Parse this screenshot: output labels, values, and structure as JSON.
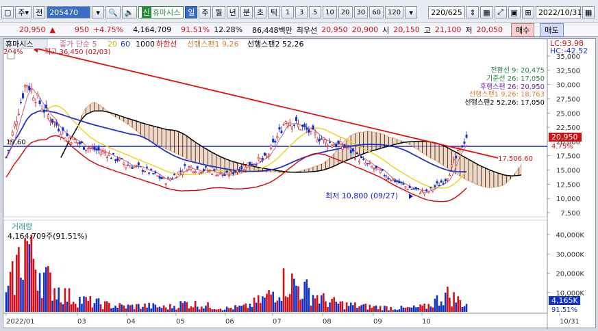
{
  "toolbar": {
    "market": "주",
    "jeon": "전",
    "code": "205470",
    "stock_name": "휴마시스",
    "stock_tag": "신",
    "period_day": "일",
    "period_week": "주",
    "period_month": "월",
    "period_year": "년",
    "period_min": "분",
    "period_tick": "초",
    "period_tick2": "틱",
    "intervals": [
      "1",
      "3",
      "5",
      "10",
      "20",
      "30",
      "60",
      "120"
    ],
    "count": "220/625",
    "date": "2022/10/31"
  },
  "quote": {
    "price": "20,950",
    "arrow": "▲",
    "change": "950",
    "change_pct": "+4.75%",
    "volume": "4,164,709",
    "vol_ratio": "91.51%",
    "turnover": "12.28%",
    "amount": "86,448백만",
    "best_ask_label": "최우선",
    "best_ask": "20,950",
    "best_bid": "20,900",
    "open_label": "시",
    "open": "20,150",
    "high_label": "고",
    "high": "21,100",
    "low_label": "저",
    "low": "20,050",
    "buy_label": "매수",
    "sell_label": "매도"
  },
  "price_pane": {
    "stock_label": "휴마시스",
    "legend_ma": "종가 단순 5",
    "legend_20": "20",
    "legend_60": "60",
    "legend_1000": "1000",
    "legend_lower": "하한선",
    "legend_span1": "선행스팬1 9,26",
    "legend_span2": "선행스팬2 52,26",
    "lc": "LC:93.98",
    "hc": "HC:-42.52",
    "pct_label": "204%",
    "high_note": "최고 36,450 (02/03)",
    "low_note": "최저 10,800 (09/27)",
    "left_level": "19,60",
    "cloud_level": "17,506.60",
    "cur_price_tag": "20,950",
    "cur_pct_tag": "4.75%",
    "ichimoku": [
      "전환선 9: 20,475",
      "기준선 26: 17,050",
      "후행스팬 26: 20,950",
      "선행스팬1 9,26: 18,763",
      "선행스팬2 52,26: 17,050"
    ],
    "y_ticks": [
      "35,000",
      "32,500",
      "30,000",
      "27,500",
      "25,000",
      "22,500",
      "20,000",
      "17,500",
      "15,000",
      "12,500",
      "10,000",
      "7,500"
    ]
  },
  "volume_pane": {
    "title": "거래량",
    "info": "4,164,709주(91.51%)",
    "y_ticks": [
      "40,000K",
      "30,000K",
      "20,000K",
      "10,000K"
    ],
    "cur_tag": "4,165K",
    "cur_pct": "91.51%"
  },
  "x_axis": [
    "2022/01",
    "03",
    "04",
    "05",
    "06",
    "07",
    "08",
    "09",
    "10",
    "10/31"
  ],
  "colors": {
    "up": "#d0101a",
    "down": "#1030c8",
    "ma5": "#e8a0c0",
    "ma20": "#e8d820",
    "ma60": "#2030c8",
    "cloud": "#d0803a",
    "trend": "#e01010"
  },
  "chart_data": {
    "type": "candlestick",
    "title": "휴마시스",
    "ylabel": "",
    "ylim": [
      7500,
      36450
    ],
    "categories": [
      "2022/01",
      "03",
      "04",
      "05",
      "06",
      "07",
      "08",
      "09",
      "10"
    ],
    "close": [
      17200,
      30500,
      25000,
      21000,
      19000,
      18000,
      16000,
      15000,
      13000,
      15500,
      15000,
      14000,
      16000,
      17000,
      24000,
      22000,
      20000,
      19000,
      16000,
      14000,
      12000,
      11000,
      13500,
      20950
    ],
    "volume_k": [
      8000,
      40000,
      18000,
      9000,
      6000,
      4000,
      3000,
      3500,
      2500,
      5000,
      3500,
      2000,
      3000,
      8000,
      18000,
      12000,
      6000,
      4000,
      3000,
      2500,
      2000,
      3000,
      10000,
      4165
    ]
  }
}
